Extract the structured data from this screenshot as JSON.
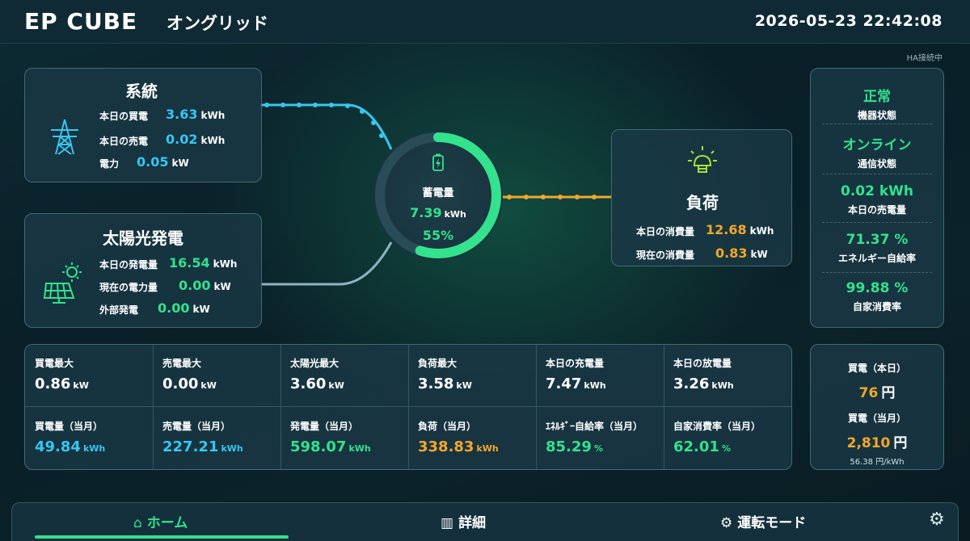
{
  "header": {
    "brand": "EP CUBE",
    "mode": "オングリッド",
    "datetime": "2026-05-23 22:42:08",
    "ha_status": "HA接続中"
  },
  "grid": {
    "title": "系統",
    "icon": "transmission-tower-icon",
    "rows": [
      {
        "label": "本日の買電",
        "value": "3.63",
        "unit": "kWh"
      },
      {
        "label": "本日の売電",
        "value": "0.02",
        "unit": "kWh"
      },
      {
        "label": "電力",
        "value": "0.05",
        "unit": "kW"
      }
    ]
  },
  "solar": {
    "title": "太陽光発電",
    "icon": "solar-panel-icon",
    "rows": [
      {
        "label": "本日の発電量",
        "value": "16.54",
        "unit": "kWh"
      },
      {
        "label": "現在の電力量",
        "value": "0.00",
        "unit": "kW"
      },
      {
        "label": "外部発電",
        "value": "0.00",
        "unit": "kW"
      }
    ]
  },
  "battery": {
    "icon": "battery-charging-icon",
    "label": "蓄電量",
    "value": "7.39",
    "unit": "kWh",
    "percent_text": "55%",
    "percent": 55
  },
  "load": {
    "title": "負荷",
    "icon": "light-bulb-icon",
    "rows": [
      {
        "label": "本日の消費量",
        "value": "12.68",
        "unit": "kWh"
      },
      {
        "label": "現在の消費量",
        "value": "0.83",
        "unit": "kW"
      }
    ]
  },
  "status": [
    {
      "value": "正常",
      "label": "機器状態"
    },
    {
      "value": "オンライン",
      "label": "通信状態"
    },
    {
      "value": "0.02 kWh",
      "label": "本日の売電量"
    },
    {
      "value": "71.37 %",
      "label": "エネルギー自給率"
    },
    {
      "value": "99.88 %",
      "label": "自家消費率"
    }
  ],
  "stats": [
    {
      "label": "買電最大",
      "value": "0.86",
      "unit": "kW",
      "color": "#ffffff"
    },
    {
      "label": "売電最大",
      "value": "0.00",
      "unit": "kW",
      "color": "#ffffff"
    },
    {
      "label": "太陽光最大",
      "value": "3.60",
      "unit": "kW",
      "color": "#ffffff"
    },
    {
      "label": "負荷最大",
      "value": "3.58",
      "unit": "kW",
      "color": "#ffffff"
    },
    {
      "label": "本日の充電量",
      "value": "7.47",
      "unit": "kWh",
      "color": "#ffffff"
    },
    {
      "label": "本日の放電量",
      "value": "3.26",
      "unit": "kWh",
      "color": "#ffffff"
    },
    {
      "label": "買電量（当月）",
      "value": "49.84",
      "unit": "kWh",
      "color": "#38c6f0"
    },
    {
      "label": "売電量（当月）",
      "value": "227.21",
      "unit": "kWh",
      "color": "#38c6f0"
    },
    {
      "label": "発電量（当月）",
      "value": "598.07",
      "unit": "kWh",
      "color": "#33e28c"
    },
    {
      "label": "負荷（当月）",
      "value": "338.83",
      "unit": "kWh",
      "color": "#f4a72a"
    },
    {
      "label": "ｴﾈﾙｷﾞｰ自給率（当月）",
      "value": "85.29",
      "unit": "%",
      "color": "#33e28c"
    },
    {
      "label": "自家消費率（当月）",
      "value": "62.01",
      "unit": "%",
      "color": "#33e28c"
    }
  ],
  "price": {
    "today_label": "買電（本日）",
    "today_value": "76",
    "today_unit": "円",
    "month_label": "買電（当月）",
    "month_value": "2,810",
    "month_unit": "円",
    "rate": "56.38 円/kWh"
  },
  "nav": {
    "home": {
      "icon": "home-icon",
      "label": "ホーム"
    },
    "detail": {
      "icon": "grid-icon",
      "label": "詳細"
    },
    "mode": {
      "icon": "gear-icon",
      "label": "運転モード"
    },
    "settings_icon": "settings-icon"
  },
  "colors": {
    "accent_green": "#33e28c",
    "accent_blue": "#38c6f0",
    "accent_orange": "#f4a72a",
    "card_bg": "#1a3846"
  }
}
